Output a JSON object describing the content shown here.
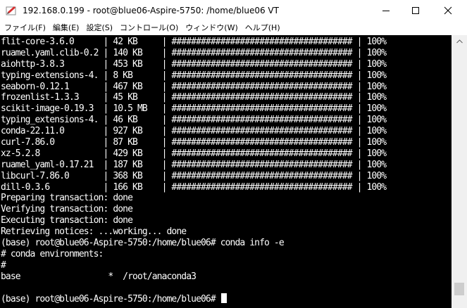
{
  "window": {
    "title": "192.168.0.199 - root@blue06-Aspire-5750: /home/blue06 VT",
    "icon": "teraterm-app-icon",
    "controls": [
      "minimize-icon",
      "maximize-icon",
      "close-icon"
    ]
  },
  "menu": {
    "items": [
      "ファイル(F)",
      "編集(E)",
      "設定(S)",
      "コントロール(O)",
      "ウィンドウ(W)",
      "ヘルプ(H)"
    ]
  },
  "terminal": {
    "lines": [
      "flit-core-3.6.0      | 42 KB     | ##################################### | 100%",
      "ruamel.yaml.clib-0.2 | 140 KB    | ##################################### | 100%",
      "aiohttp-3.8.3        | 453 KB    | ##################################### | 100%",
      "typing-extensions-4. | 8 KB      | ##################################### | 100%",
      "seaborn-0.12.1       | 467 KB    | ##################################### | 100%",
      "frozenlist-1.3.3     | 45 KB     | ##################################### | 100%",
      "scikit-image-0.19.3  | 10.5 MB   | ##################################### | 100%",
      "typing_extensions-4. | 46 KB     | ##################################### | 100%",
      "conda-22.11.0        | 927 KB    | ##################################### | 100%",
      "curl-7.86.0          | 87 KB     | ##################################### | 100%",
      "xz-5.2.8             | 429 KB    | ##################################### | 100%",
      "ruamel_yaml-0.17.21  | 187 KB    | ##################################### | 100%",
      "libcurl-7.86.0       | 368 KB    | ##################################### | 100%",
      "dill-0.3.6           | 166 KB    | ##################################### | 100%",
      "Preparing transaction: done",
      "Verifying transaction: done",
      "Executing transaction: done",
      "Retrieving notices: ...working... done",
      "(base) root@blue06-Aspire-5750:/home/blue06# conda info -e",
      "# conda environments:",
      "#",
      "base                  *  /root/anaconda3",
      "",
      "(base) root@blue06-Aspire-5750:/home/blue06# "
    ],
    "background": "#000000",
    "foreground": "#ffffff"
  },
  "scrollbar": {
    "position": 0.96
  }
}
